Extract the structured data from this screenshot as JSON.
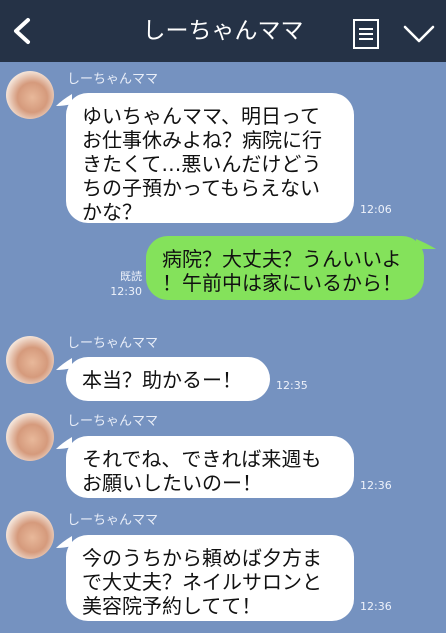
{
  "header": {
    "title": "しーちゃんママ",
    "back_icon": "chevron-left-icon",
    "menu_icon": "list-icon",
    "dropdown_icon": "chevron-down-icon",
    "background": "#253246"
  },
  "chat": {
    "background": "#7592c0",
    "messages": [
      {
        "sender": "しーちゃんママ",
        "text": "ゆいちゃんママ、明日って\nお仕事休みよね？病院に行\nきたくて…悪いんだけどう\nちの子預かってもらえない\nかな？",
        "time": "12:06"
      },
      {
        "sender": "me",
        "text": "病院？大丈夫？うんいいよ\n！午前中は家にいるから！",
        "read": "既読",
        "time": "12:30"
      },
      {
        "sender": "しーちゃんママ",
        "text": "本当？助かるー！",
        "time": "12:35"
      },
      {
        "sender": "しーちゃんママ",
        "text": "それでね、できれば来週も\nお願いしたいのー！",
        "time": "12:36"
      },
      {
        "sender": "しーちゃんママ",
        "text": "今のうちから頼めば夕方ま\nで大丈夫？ネイルサロンと\n美容院予約してて！",
        "time": "12:36"
      }
    ]
  },
  "colors": {
    "incoming_bubble": "#ffffff",
    "outgoing_bubble": "#84e25b"
  }
}
